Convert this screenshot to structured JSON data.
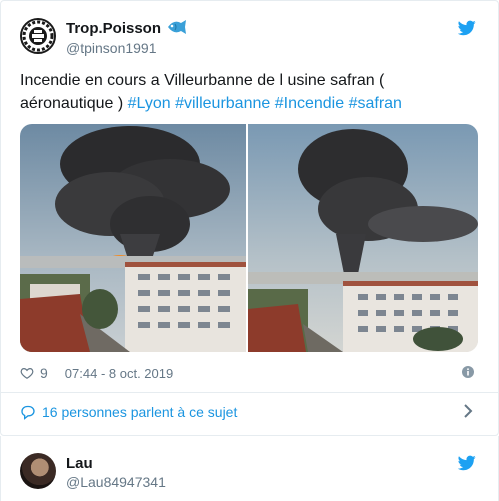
{
  "tweet": {
    "display_name": "Trop.Poisson",
    "handle": "@tpinson1991",
    "text": "Incendie en cours a Villeurbanne de l usine safran ( aéronautique ) ",
    "hashtags": [
      "#Lyon",
      "#villeurbanne",
      "#Incendie",
      "#safran"
    ],
    "likes": "9",
    "timestamp": "07:44 - 8 oct. 2019",
    "conversation_link": "16 personnes parlent à ce sujet",
    "icons": [
      "avatar-logo",
      "fish-emoji",
      "twitter-bird-icon",
      "heart-icon",
      "info-icon",
      "speech-bubble-icon",
      "chevron-right-icon"
    ]
  },
  "reply_tweet": {
    "display_name": "Lau",
    "handle": "@Lau84947341"
  },
  "colors": {
    "link": "#1b95e0",
    "secondary_text": "#657786",
    "border": "#e6ecf0",
    "twitter_blue": "#1da1f2"
  }
}
